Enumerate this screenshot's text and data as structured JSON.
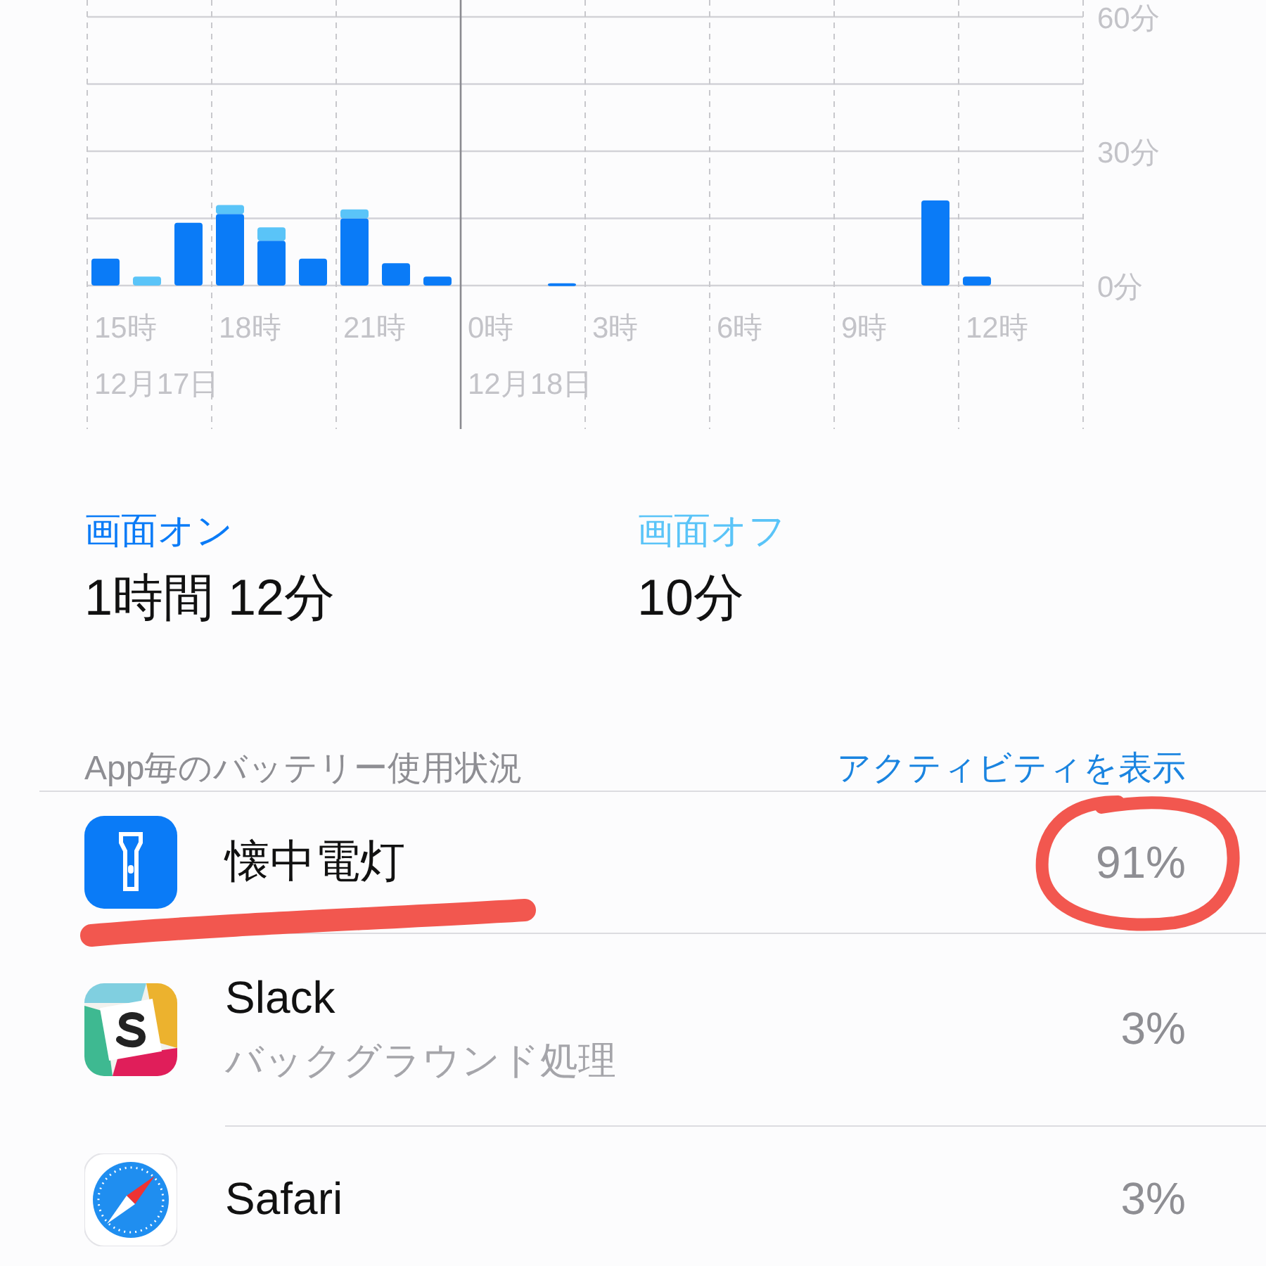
{
  "chart_data": {
    "type": "bar",
    "stacked": true,
    "categories": [
      "15時",
      null,
      null,
      "18時",
      null,
      null,
      "21時",
      null,
      null,
      "0時",
      null,
      null,
      "3時",
      null,
      null,
      "6時",
      null,
      null,
      "9時",
      null,
      null,
      "12時",
      null,
      null
    ],
    "series": [
      {
        "color": "#0a7bf7",
        "values": [
          6,
          0,
          14,
          16,
          10,
          6,
          15,
          5,
          2,
          0,
          0,
          0.5,
          0,
          0,
          0,
          0,
          0,
          0,
          0,
          0,
          19,
          2,
          0,
          0
        ]
      },
      {
        "color": "#5ac4f8",
        "values": [
          0,
          2,
          0,
          2,
          3,
          0,
          2,
          0,
          0,
          0,
          0,
          0,
          0,
          0,
          0,
          0,
          0,
          0,
          0,
          0,
          0,
          0,
          0,
          0
        ]
      }
    ],
    "ylim": [
      0,
      60
    ],
    "grid": true,
    "yticks": [
      {
        "value": 0,
        "label": "0分"
      },
      {
        "value": 30,
        "label": "30分"
      },
      {
        "value": 60,
        "label": "60分"
      }
    ]
  },
  "date_labels": [
    "12月17日",
    "12月18日"
  ],
  "summary": [
    {
      "label": "画面オン",
      "value": "1時間 12分",
      "color": "#0a7bf7"
    },
    {
      "label": "画面オフ",
      "value": "10分",
      "color": "#5ac4f8"
    }
  ],
  "list_header": {
    "title": "App毎のバッテリー使用状況",
    "link": "アクティビティを表示"
  },
  "apps": [
    {
      "name": "懐中電灯",
      "percent": "91%"
    },
    {
      "name": "Slack",
      "subtitle": "バックグラウンド処理",
      "percent": "3%"
    },
    {
      "name": "Safari",
      "percent": "3%"
    }
  ]
}
